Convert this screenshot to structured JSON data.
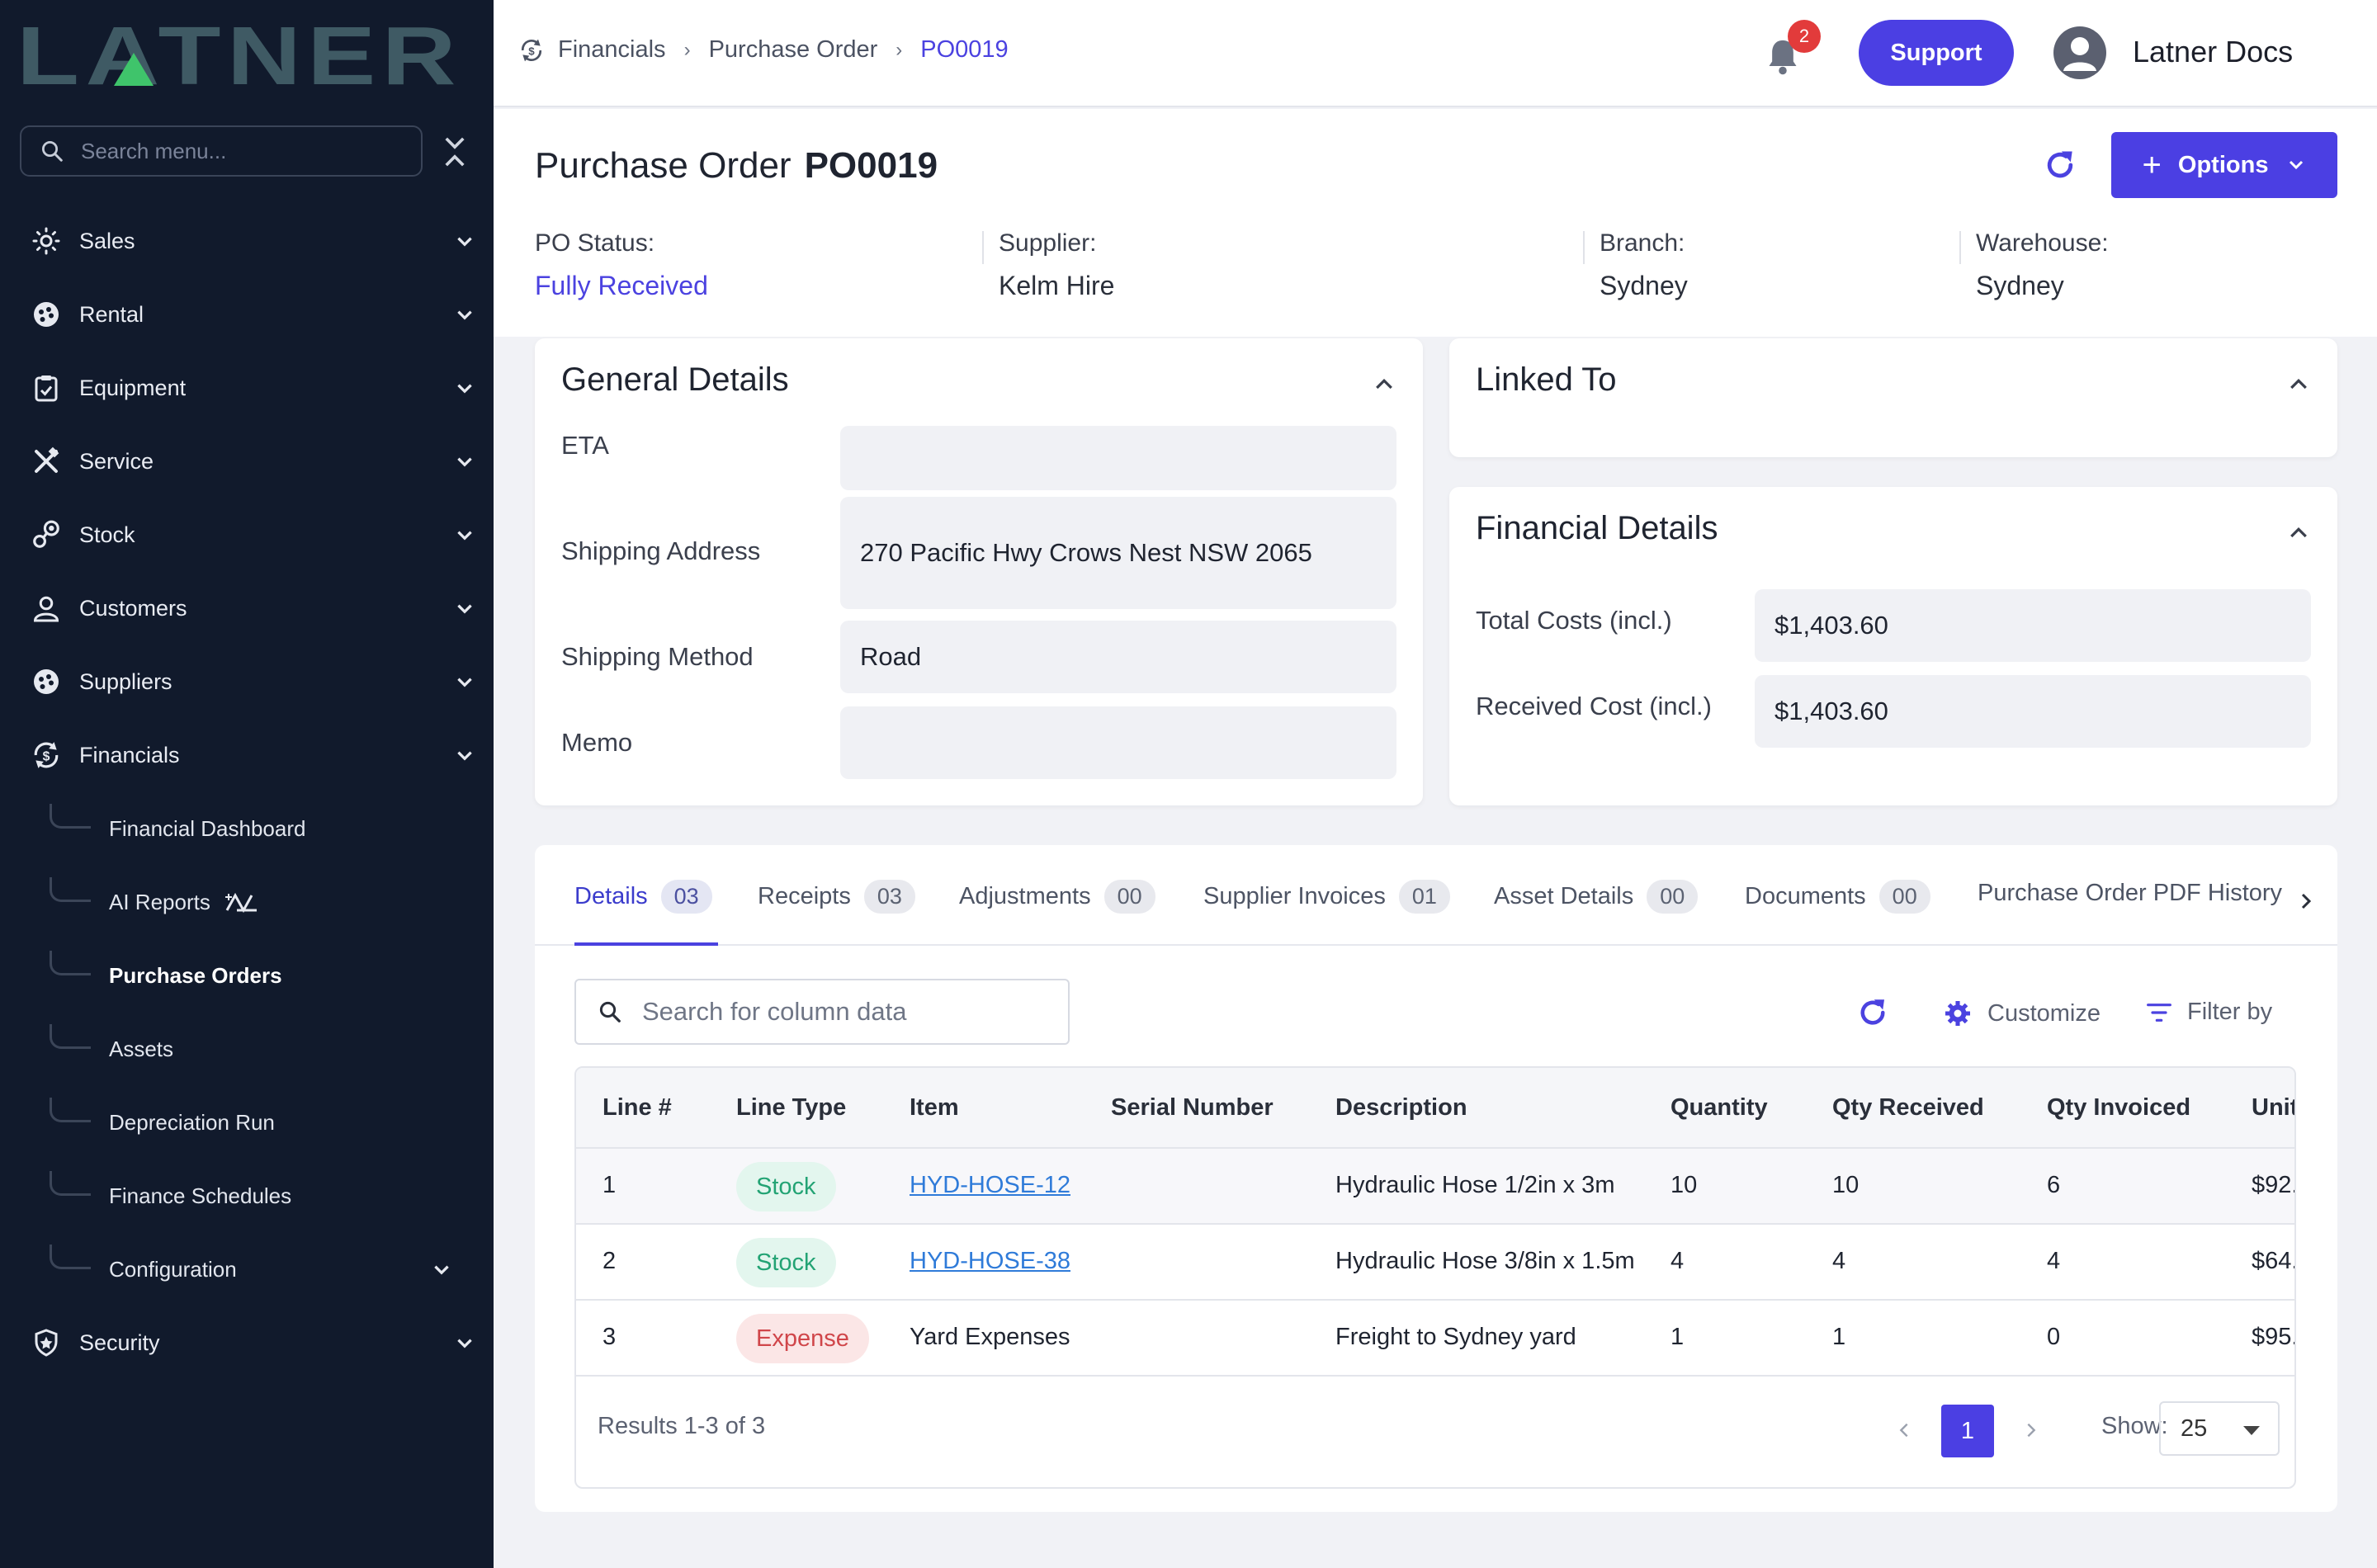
{
  "sidebar": {
    "logo_text": "LATNER",
    "search_placeholder": "Search menu...",
    "items": [
      {
        "label": "Sales",
        "icon": "sales-icon"
      },
      {
        "label": "Rental",
        "icon": "rental-icon"
      },
      {
        "label": "Equipment",
        "icon": "clipboard-icon"
      },
      {
        "label": "Service",
        "icon": "tools-icon"
      },
      {
        "label": "Stock",
        "icon": "stock-icon"
      },
      {
        "label": "Customers",
        "icon": "user-icon"
      },
      {
        "label": "Suppliers",
        "icon": "suppliers-icon"
      },
      {
        "label": "Financials",
        "icon": "financials-icon"
      },
      {
        "label": "Security",
        "icon": "shield-icon"
      }
    ],
    "financials_sub": [
      {
        "label": "Financial Dashboard"
      },
      {
        "label": "AI Reports"
      },
      {
        "label": "Purchase Orders"
      },
      {
        "label": "Assets"
      },
      {
        "label": "Depreciation Run"
      },
      {
        "label": "Finance Schedules"
      },
      {
        "label": "Configuration"
      }
    ]
  },
  "topbar": {
    "breadcrumb": [
      "Financials",
      "Purchase Order",
      "PO0019"
    ],
    "notification_count": "2",
    "support_label": "Support",
    "user_name": "Latner Docs"
  },
  "header": {
    "title_prefix": "Purchase Order",
    "po_number": "PO0019",
    "options_label": "Options",
    "meta": [
      {
        "label": "PO Status:",
        "value": "Fully Received"
      },
      {
        "label": "Supplier:",
        "value": "Kelm Hire"
      },
      {
        "label": "Branch:",
        "value": "Sydney"
      },
      {
        "label": "Warehouse:",
        "value": "Sydney"
      }
    ]
  },
  "general_details": {
    "title": "General Details",
    "fields": [
      {
        "label": "ETA",
        "value": ""
      },
      {
        "label": "Shipping Address",
        "value": "270 Pacific Hwy Crows Nest NSW 2065"
      },
      {
        "label": "Shipping Method",
        "value": "Road"
      },
      {
        "label": "Memo",
        "value": ""
      }
    ]
  },
  "linked_to": {
    "title": "Linked To"
  },
  "financial_details": {
    "title": "Financial Details",
    "fields": [
      {
        "label": "Total Costs (incl.)",
        "value": "$1,403.60"
      },
      {
        "label": "Received Cost (incl.)",
        "value": "$1,403.60"
      }
    ]
  },
  "tabs": [
    {
      "label": "Details",
      "count": "03"
    },
    {
      "label": "Receipts",
      "count": "03"
    },
    {
      "label": "Adjustments",
      "count": "00"
    },
    {
      "label": "Supplier Invoices",
      "count": "01"
    },
    {
      "label": "Asset Details",
      "count": "00"
    },
    {
      "label": "Documents",
      "count": "00"
    },
    {
      "label": "Purchase Order PDF History"
    }
  ],
  "table_tools": {
    "search_placeholder": "Search for column data",
    "customize_label": "Customize",
    "filter_label": "Filter by"
  },
  "table": {
    "columns": [
      "Line #",
      "Line Type",
      "Item",
      "Serial Number",
      "Description",
      "Quantity",
      "Qty Received",
      "Qty Invoiced",
      "Unit"
    ],
    "rows": [
      {
        "line": "1",
        "type": "Stock",
        "item": "HYD-HOSE-12",
        "serial": "",
        "description": "Hydraulic Hose 1/2in x 3m",
        "qty": "10",
        "received": "10",
        "invoiced": "6",
        "unit": "$92."
      },
      {
        "line": "2",
        "type": "Stock",
        "item": "HYD-HOSE-38",
        "serial": "",
        "description": "Hydraulic Hose 3/8in x 1.5m",
        "qty": "4",
        "received": "4",
        "invoiced": "4",
        "unit": "$64."
      },
      {
        "line": "3",
        "type": "Expense",
        "item": "Yard Expenses",
        "serial": "",
        "description": "Freight to Sydney yard",
        "qty": "1",
        "received": "1",
        "invoiced": "0",
        "unit": "$95."
      }
    ],
    "results_text": "Results 1-3 of 3",
    "current_page": "1",
    "show_label": "Show:",
    "page_size": "25"
  }
}
